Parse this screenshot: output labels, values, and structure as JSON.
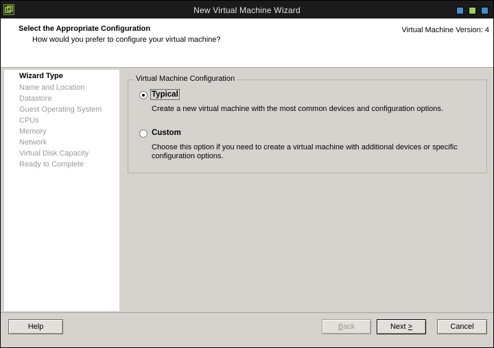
{
  "window": {
    "title": "New Virtual Machine Wizard"
  },
  "header": {
    "title": "Select the Appropriate Configuration",
    "subtitle": "How would you prefer to configure your virtual machine?",
    "version": "Virtual Machine Version: 4"
  },
  "steps": [
    {
      "label": "Wizard Type",
      "active": true
    },
    {
      "label": "Name and Location",
      "active": false
    },
    {
      "label": "Datastore",
      "active": false
    },
    {
      "label": "Guest Operating System",
      "active": false
    },
    {
      "label": "CPUs",
      "active": false
    },
    {
      "label": "Memory",
      "active": false
    },
    {
      "label": "Network",
      "active": false
    },
    {
      "label": "Virtual Disk Capacity",
      "active": false
    },
    {
      "label": "Ready to Complete",
      "active": false
    }
  ],
  "config": {
    "group_label": "Virtual Machine Configuration",
    "options": [
      {
        "label": "Typical",
        "selected": true,
        "description_lines": [
          "Create a new virtual machine with the most common devices and configuration options."
        ]
      },
      {
        "label": "Custom",
        "selected": false,
        "description_lines": [
          "Choose this option if you need to create a virtual machine with additional devices or specific",
          "configuration options."
        ]
      }
    ]
  },
  "buttons": {
    "help": "Help",
    "back": {
      "prefix": "",
      "mnemonic": "B",
      "suffix": "ack",
      "enabled": false
    },
    "next": {
      "prefix": "Next ",
      "mnemonic": ">",
      "suffix": "",
      "enabled": true
    },
    "cancel": "Cancel"
  },
  "colors": {
    "titlebar": "#1b1b1b",
    "header_bg": "#ffffff",
    "dialog_bg": "#d6d3ce",
    "inactive_step": "#9a9a9a",
    "minimize_btn": "#3f8ecf",
    "maximize_btn": "#9dd15d"
  }
}
